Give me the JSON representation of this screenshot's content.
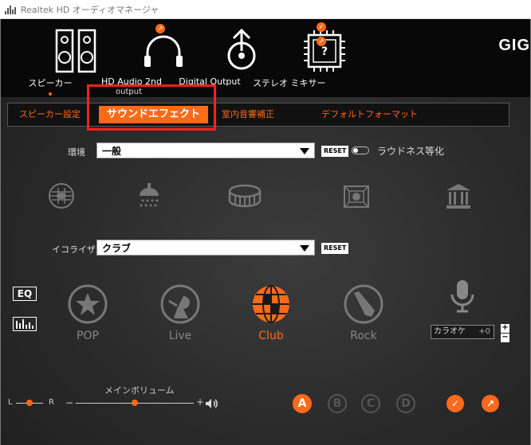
{
  "window": {
    "title": "Realtek HD オーディオマネージャ"
  },
  "devices": [
    {
      "label": "スピーカー",
      "icon": "speaker-icon"
    },
    {
      "label": "HD Audio 2nd",
      "icon": "headphones-icon"
    },
    {
      "label": "Digital Output",
      "icon": "digital-output-icon"
    },
    {
      "label": "ステレオ ミキサー",
      "icon": "stereo-mixer-icon"
    }
  ],
  "device_subtitle": "output",
  "brand": "GIG",
  "tabs": [
    {
      "label": "スピーカー設定"
    },
    {
      "label": "サウンドエフェクト"
    },
    {
      "label": "室内音響補正"
    },
    {
      "label": "デフォルトフォーマット"
    }
  ],
  "environment": {
    "label": "環境",
    "value": "一般",
    "reset": "RESET",
    "loudness_label": "ラウドネス等化",
    "icons": [
      "stone-room-icon",
      "shower-icon",
      "arena-icon",
      "box-room-icon",
      "hall-icon"
    ]
  },
  "equalizer": {
    "label": "イコライザ",
    "value": "クラブ",
    "reset": "RESET",
    "eq_button": "EQ",
    "presets": [
      {
        "label": "POP",
        "icon": "pop-icon"
      },
      {
        "label": "Live",
        "icon": "live-icon"
      },
      {
        "label": "Club",
        "icon": "club-icon"
      },
      {
        "label": "Rock",
        "icon": "rock-icon"
      }
    ],
    "karaoke_label": "カラオケ",
    "karaoke_value": "+0"
  },
  "volume": {
    "label": "メインボリューム",
    "balance_left": "L",
    "balance_right": "R",
    "minus": "−",
    "plus": "+",
    "level": 0.5
  },
  "profiles": [
    "A",
    "B",
    "C",
    "D"
  ],
  "colors": {
    "accent": "#ff6a1a",
    "highlight": "#ff2020",
    "background": "#2a2a2a"
  }
}
